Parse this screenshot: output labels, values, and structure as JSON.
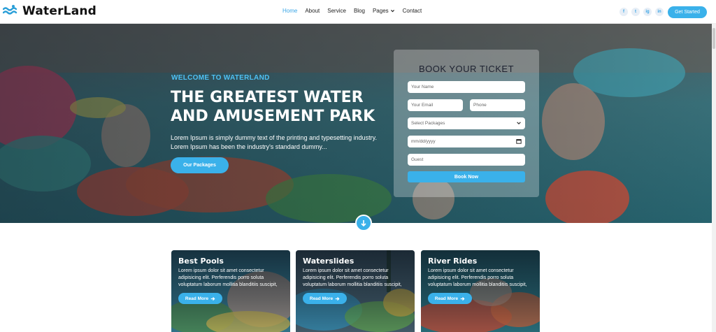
{
  "brand": {
    "name": "WaterLand",
    "icon": "waves-icon"
  },
  "nav": {
    "items": [
      {
        "label": "Home",
        "active": true
      },
      {
        "label": "About",
        "active": false
      },
      {
        "label": "Service",
        "active": false
      },
      {
        "label": "Blog",
        "active": false
      },
      {
        "label": "Pages",
        "active": false,
        "dropdown": true
      },
      {
        "label": "Contact",
        "active": false
      }
    ],
    "socials": [
      "f",
      "t",
      "ig",
      "in"
    ],
    "cta": "Get Started"
  },
  "hero": {
    "welcome": "WELCOME TO WATERLAND",
    "title": "THE GREATEST WATER AND AMUSEMENT PARK",
    "description": "Lorem Ipsum is simply dummy text of the printing and typesetting industry. Lorem Ipsum has been the industry's standard dummy...",
    "button": "Our Packages"
  },
  "booking": {
    "title": "BOOK YOUR TICKET",
    "name_placeholder": "Your Name",
    "email_placeholder": "Your Email",
    "phone_placeholder": "Phone",
    "package_select": "Select Packages",
    "date_placeholder": "mm/dd/yyyy",
    "guest_placeholder": "Guest",
    "submit": "Book Now"
  },
  "cards": [
    {
      "title": "Best Pools",
      "text": "Lorem ipsum dolor sit amet consectetur adipisicing elit. Perferendis porro soluta voluptatum laborum mollitia blanditiis suscipit,",
      "button": "Read More"
    },
    {
      "title": "Waterslides",
      "text": "Lorem ipsum dolor sit amet consectetur adipisicing elit. Perferendis porro soluta voluptatum laborum mollitia blanditiis suscipit,",
      "button": "Read More"
    },
    {
      "title": "River Rides",
      "text": "Lorem ipsum dolor sit amet consectetur adipisicing elit. Perferendis porro soluta voluptatum laborum mollitia blanditiis suscipit,",
      "button": "Read More"
    }
  ],
  "colors": {
    "accent": "#3ab1ea",
    "welcome": "#4ec2f5",
    "title": "#ffffff",
    "dark": "#1c2130"
  }
}
